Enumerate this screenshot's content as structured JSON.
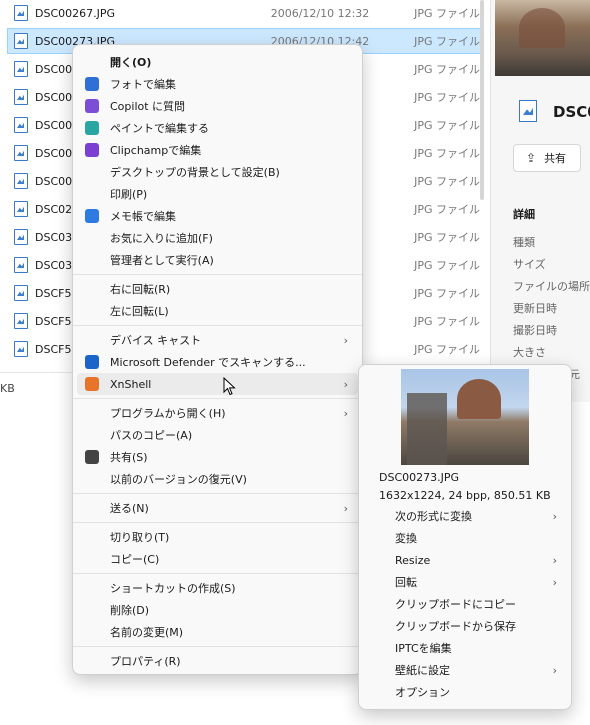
{
  "explorer": {
    "files": [
      {
        "name": "DSC00267.JPG",
        "date": "2006/12/10 12:32",
        "type": "JPG ファイル"
      },
      {
        "name": "DSC00273.JPG",
        "date": "2006/12/10 12:42",
        "type": "JPG ファイル"
      },
      {
        "name": "DSC002",
        "date": "",
        "type": "JPG ファイル"
      },
      {
        "name": "DSC002",
        "date": "",
        "type": "JPG ファイル"
      },
      {
        "name": "DSC002",
        "date": "",
        "type": "JPG ファイル"
      },
      {
        "name": "DSC003",
        "date": "",
        "type": "JPG ファイル"
      },
      {
        "name": "DSC003",
        "date": "",
        "type": "JPG ファイル"
      },
      {
        "name": "DSC027",
        "date": "",
        "type": "JPG ファイル"
      },
      {
        "name": "DSC030",
        "date": "",
        "type": "JPG ファイル"
      },
      {
        "name": "DSC030",
        "date": "",
        "type": "JPG ファイル"
      },
      {
        "name": "DSCF57",
        "date": "",
        "type": "JPG ファイル"
      },
      {
        "name": "DSCF57",
        "date": "",
        "type": "JPG ファイル"
      },
      {
        "name": "DSCF58",
        "date": "",
        "type": "JPG ファイル"
      }
    ],
    "status_text": "KB"
  },
  "details": {
    "title": "DSC0",
    "share_label": "共有",
    "section_label": "詳細",
    "props": [
      "種類",
      "サイズ",
      "ファイルの場所",
      "更新日時",
      "撮影日時",
      "大きさ",
      "元"
    ]
  },
  "context_menu": {
    "items": [
      {
        "label": "開く(O)",
        "bold": true
      },
      {
        "label": "フォトで編集",
        "icon": "photos-icon",
        "color": "#2f6fd6"
      },
      {
        "label": "Copilot に質問",
        "icon": "copilot-icon",
        "color": "#7c4dd6"
      },
      {
        "label": "ペイントで編集する",
        "icon": "paint-icon",
        "color": "#2aa6a0"
      },
      {
        "label": "Clipchampで編集",
        "icon": "clipchamp-icon",
        "color": "#7b3fd1"
      },
      {
        "label": "デスクトップの背景として設定(B)"
      },
      {
        "label": "印刷(P)"
      },
      {
        "label": "メモ帳で編集",
        "icon": "notepad-icon",
        "color": "#2d7be0"
      },
      {
        "label": "お気に入りに追加(F)"
      },
      {
        "label": "管理者として実行(A)"
      },
      {
        "sep": true
      },
      {
        "label": "右に回転(R)"
      },
      {
        "label": "左に回転(L)"
      },
      {
        "sep": true
      },
      {
        "label": "デバイス キャスト",
        "arrow": true
      },
      {
        "label": "Microsoft Defender でスキャンする...",
        "icon": "defender-icon",
        "color": "#1b64c9"
      },
      {
        "label": "XnShell",
        "arrow": true,
        "hover": true,
        "icon": "xnshell-icon",
        "color": "#e8732a"
      },
      {
        "sep": true
      },
      {
        "label": "プログラムから開く(H)",
        "arrow": true
      },
      {
        "label": "パスのコピー(A)"
      },
      {
        "label": "共有(S)",
        "icon": "share-icon",
        "color": "#444444"
      },
      {
        "label": "以前のバージョンの復元(V)"
      },
      {
        "sep": true
      },
      {
        "label": "送る(N)",
        "arrow": true
      },
      {
        "sep": true
      },
      {
        "label": "切り取り(T)"
      },
      {
        "label": "コピー(C)"
      },
      {
        "sep": true
      },
      {
        "label": "ショートカットの作成(S)"
      },
      {
        "label": "削除(D)"
      },
      {
        "label": "名前の変更(M)"
      },
      {
        "sep": true
      },
      {
        "label": "プロパティ(R)"
      }
    ]
  },
  "submenu": {
    "file_name": "DSC00273.JPG",
    "file_info": "1632x1224, 24 bpp, 850.51 KB",
    "items": [
      {
        "label": "次の形式に変換",
        "arrow": true
      },
      {
        "label": "変換"
      },
      {
        "label": "Resize",
        "arrow": true
      },
      {
        "label": "回転",
        "arrow": true
      },
      {
        "label": "クリップボードにコピー"
      },
      {
        "label": "クリップボードから保存"
      },
      {
        "label": "IPTCを編集"
      },
      {
        "label": "壁紙に設定",
        "arrow": true
      },
      {
        "label": "オプション"
      }
    ]
  }
}
